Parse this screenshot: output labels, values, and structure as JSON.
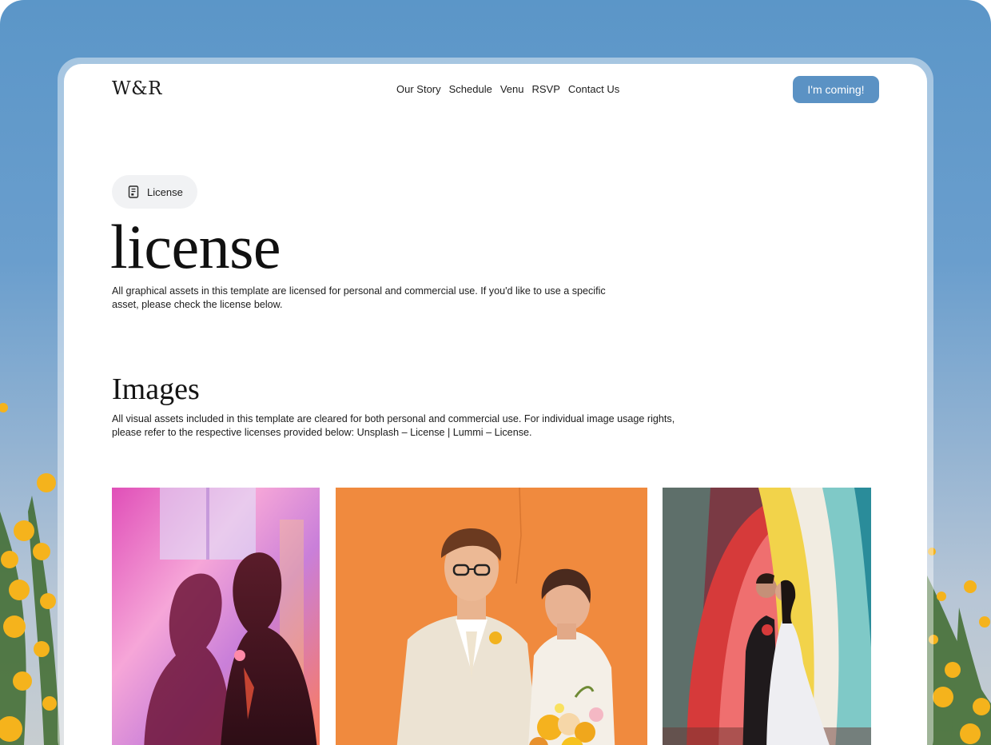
{
  "header": {
    "logo": "W&R",
    "nav": [
      "Our Story",
      "Schedule",
      "Venu",
      "RSVP",
      "Contact Us"
    ],
    "cta_label": "I'm coming!"
  },
  "badge": {
    "label": "License",
    "icon": "document-icon"
  },
  "hero": {
    "title": "license",
    "text": "All graphical assets in this template are licensed for personal and commercial use. If you'd like to use a specific asset, please check the license below."
  },
  "images_section": {
    "title": "Images",
    "text": "All visual assets included in this template are cleared for both personal and commercial use. For individual image usage rights, please refer to the respective licenses provided below: Unsplash – License | Lummi – License."
  },
  "photos": [
    {
      "subject": "couple-silhouette-rainbow-light"
    },
    {
      "subject": "couple-orange-wall-bouquet"
    },
    {
      "subject": "couple-kissing-rainbow-arch"
    }
  ],
  "colors": {
    "accent": "#5b92c4",
    "sky": "#5b96c8",
    "pill_bg": "#f1f2f4",
    "orange_backdrop": "#f08a3e"
  }
}
